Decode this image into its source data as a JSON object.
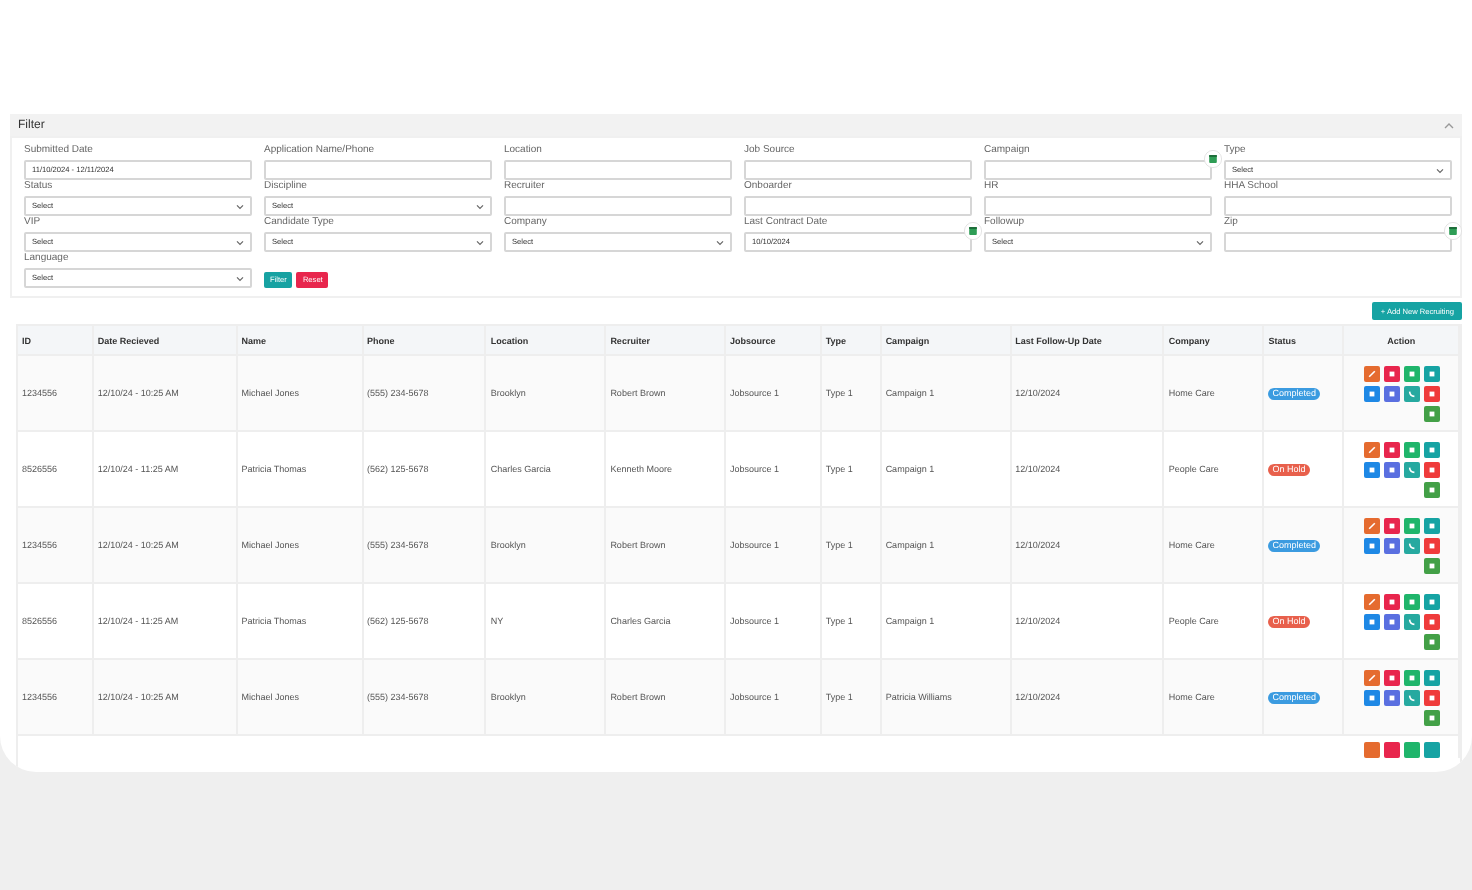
{
  "filter": {
    "title": "Filter",
    "fields": [
      {
        "label": "Submitted Date",
        "kind": "input",
        "value": "11/10/2024 - 12/11/2024"
      },
      {
        "label": "Application Name/Phone",
        "kind": "input"
      },
      {
        "label": "Location",
        "kind": "input"
      },
      {
        "label": "Job Source",
        "kind": "input"
      },
      {
        "label": "Campaign",
        "kind": "date"
      },
      {
        "label": "Type",
        "kind": "select",
        "value": "Select"
      },
      {
        "label": "Status",
        "kind": "select",
        "value": "Select"
      },
      {
        "label": "Discipline",
        "kind": "select",
        "value": "Select"
      },
      {
        "label": "Recruiter",
        "kind": "input"
      },
      {
        "label": "Onboarder",
        "kind": "input"
      },
      {
        "label": "HR",
        "kind": "input"
      },
      {
        "label": "HHA School",
        "kind": "input"
      },
      {
        "label": "VIP",
        "kind": "select",
        "value": "Select"
      },
      {
        "label": "Candidate Type",
        "kind": "select",
        "value": "Select"
      },
      {
        "label": "Company",
        "kind": "select",
        "value": "Select"
      },
      {
        "label": "Last Contract Date",
        "kind": "date",
        "value": "10/10/2024"
      },
      {
        "label": "Followup",
        "kind": "select",
        "value": "Select"
      },
      {
        "label": "Zip",
        "kind": "date"
      },
      {
        "label": "Language",
        "kind": "select",
        "value": "Select"
      }
    ],
    "buttons": [
      {
        "label": "Filter",
        "kind": "primary"
      },
      {
        "label": "Reset",
        "kind": "danger"
      }
    ]
  },
  "add_button": "+ Add New Recruiting",
  "table": {
    "columns": [
      "ID",
      "Date Recieved",
      "Name",
      "Phone",
      "Location",
      "Recruiter",
      "Jobsource",
      "Type",
      "Campaign",
      "Last Follow-Up Date",
      "Company",
      "Status",
      "Action"
    ],
    "rows": [
      {
        "cells": [
          "1234556",
          "12/10/24 - 10:25 AM",
          "Michael Jones",
          "(555) 234-5678",
          "Brooklyn",
          "Robert Brown",
          "Jobsource 1",
          "Type 1",
          "Campaign 1",
          "12/10/2024",
          "Home Care"
        ],
        "status": "Completed",
        "color": "#3b9be0"
      },
      {
        "cells": [
          "8526556",
          "12/10/24 - 11:25 AM",
          "Patricia Thomas",
          "(562) 125-5678",
          "Charles Garcia",
          "Kenneth Moore",
          "Jobsource 1",
          "Type 1",
          "Campaign 1",
          "12/10/2024",
          "People Care"
        ],
        "status": "On Hold",
        "color": "#e8604c"
      },
      {
        "cells": [
          "1234556",
          "12/10/24 - 10:25 AM",
          "Michael Jones",
          "(555) 234-5678",
          "Brooklyn",
          "Robert Brown",
          "Jobsource 1",
          "Type 1",
          "Campaign 1",
          "12/10/2024",
          "Home Care"
        ],
        "status": "Completed",
        "color": "#3b9be0"
      },
      {
        "cells": [
          "8526556",
          "12/10/24 - 11:25 AM",
          "Patricia Thomas",
          "(562) 125-5678",
          "NY",
          "Charles Garcia",
          "Jobsource 1",
          "Type 1",
          "Campaign 1",
          "12/10/2024",
          "People Care"
        ],
        "status": "On Hold",
        "color": "#e8604c"
      },
      {
        "cells": [
          "1234556",
          "12/10/24 - 10:25 AM",
          "Michael Jones",
          "(555) 234-5678",
          "Brooklyn",
          "Robert Brown",
          "Jobsource 1",
          "Type 1",
          "Patricia Williams",
          "12/10/2024",
          "Home Care"
        ],
        "status": "Completed",
        "color": "#3b9be0"
      }
    ]
  }
}
